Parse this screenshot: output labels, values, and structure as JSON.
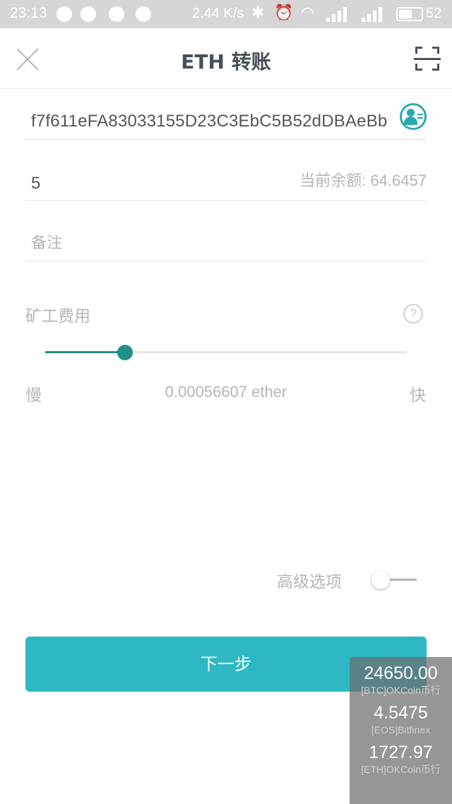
{
  "status_bar": {
    "time": "23:13",
    "speed": "2.44 K/s",
    "battery": "52"
  },
  "header": {
    "title": "ETH 转账",
    "close_icon": "close-icon",
    "scan_icon": "scan-icon"
  },
  "form": {
    "address": "f7f611eFA83033155D23C3EbC5B52dDBAeBb",
    "amount": "5",
    "balance_label": "当前余额: 64.6457",
    "memo_placeholder": "备注"
  },
  "fee": {
    "label": "矿工费用",
    "help": "?",
    "slider_value_percent": 22,
    "slow_label": "慢",
    "value": "0.00056607 ether",
    "fast_label": "快"
  },
  "advanced": {
    "label": "高级选项",
    "enabled": false
  },
  "actions": {
    "next_label": "下一步"
  },
  "ticker": [
    {
      "price": "24650.00",
      "source": "[BTC]OKCoin币行"
    },
    {
      "price": "4.5475",
      "source": "[EOS]Bitfinex"
    },
    {
      "price": "1727.97",
      "source": "[ETH]OKCoin币行"
    }
  ],
  "colors": {
    "accent": "#2db8c4",
    "slider": "#1f8f87",
    "placeholder": "#b5b5b5"
  }
}
